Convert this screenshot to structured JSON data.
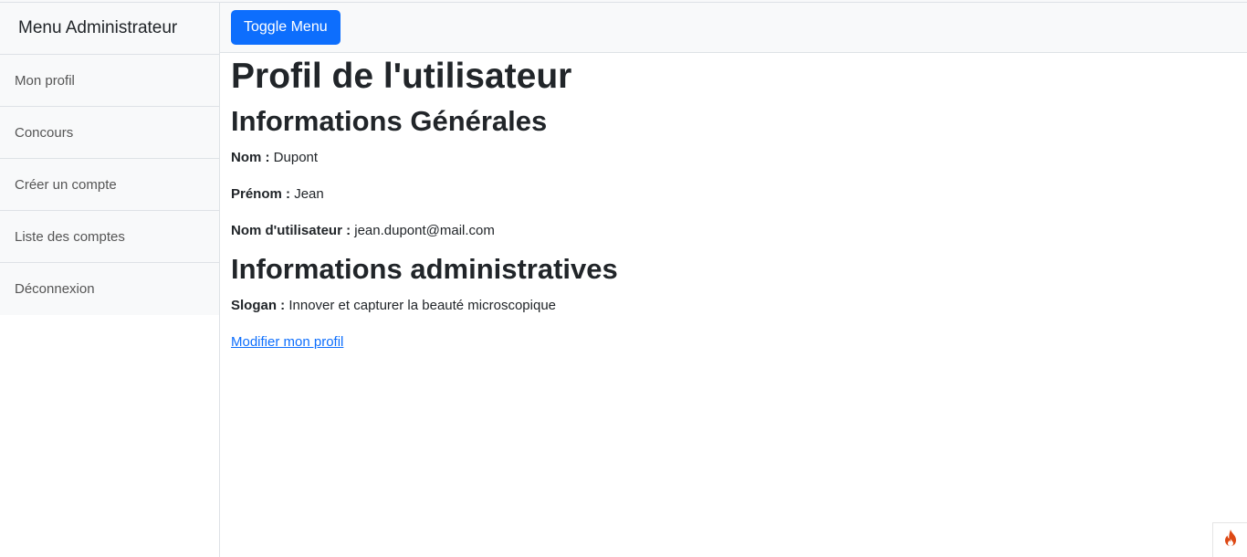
{
  "sidebar": {
    "heading": "Menu Administrateur",
    "items": [
      {
        "label": "Mon profil"
      },
      {
        "label": "Concours"
      },
      {
        "label": "Créer un compte"
      },
      {
        "label": "Liste des comptes"
      },
      {
        "label": "Déconnexion"
      }
    ]
  },
  "navbar": {
    "toggle_label": "Toggle Menu"
  },
  "main": {
    "page_title": "Profil de l'utilisateur",
    "general_title": "Informations Générales",
    "nom_label": "Nom :",
    "nom_value": "Dupont",
    "prenom_label": "Prénom :",
    "prenom_value": "Jean",
    "username_label": "Nom d'utilisateur :",
    "username_value": "jean.dupont@mail.com",
    "admin_title": "Informations administratives",
    "slogan_label": "Slogan :",
    "slogan_value": "Innover et capturer la beauté microscopique",
    "edit_link": "Modifier mon profil"
  },
  "colors": {
    "primary": "#0d6efd",
    "sidebar_bg": "#f8f9fa",
    "border": "#dee2e6",
    "debug_icon": "#dd4814"
  },
  "icons": {
    "debug_toolbar": "flame-icon"
  }
}
